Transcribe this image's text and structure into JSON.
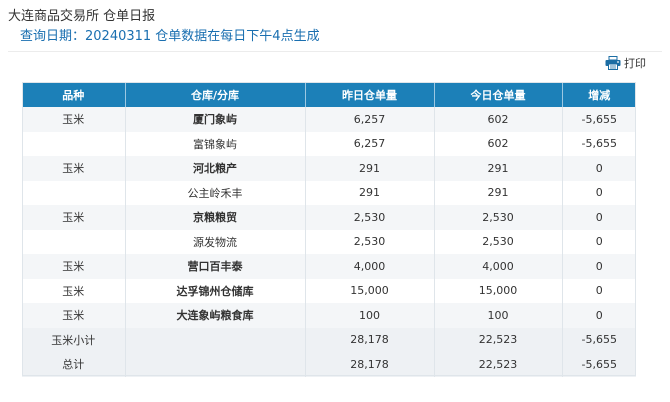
{
  "header": {
    "title": "大连商品交易所 仓单日报",
    "subtitle": "查询日期：20240311 仓单数据在每日下午4点生成"
  },
  "toolbar": {
    "print_label": "打印",
    "print_icon": "printer-icon"
  },
  "table": {
    "headers": [
      "品种",
      "仓库/分库",
      "昨日仓单量",
      "今日仓单量",
      "增减"
    ],
    "rows": [
      {
        "variety": "玉米",
        "warehouse": "厦门象屿",
        "yesterday": "6,257",
        "today": "602",
        "change": "-5,655"
      },
      {
        "variety": "",
        "warehouse": "富锦象屿",
        "yesterday": "6,257",
        "today": "602",
        "change": "-5,655"
      },
      {
        "variety": "玉米",
        "warehouse": "河北粮产",
        "yesterday": "291",
        "today": "291",
        "change": "0"
      },
      {
        "variety": "",
        "warehouse": "公主岭禾丰",
        "yesterday": "291",
        "today": "291",
        "change": "0"
      },
      {
        "variety": "玉米",
        "warehouse": "京粮粮贸",
        "yesterday": "2,530",
        "today": "2,530",
        "change": "0"
      },
      {
        "variety": "",
        "warehouse": "源发物流",
        "yesterday": "2,530",
        "today": "2,530",
        "change": "0"
      },
      {
        "variety": "玉米",
        "warehouse": "营口百丰泰",
        "yesterday": "4,000",
        "today": "4,000",
        "change": "0"
      },
      {
        "variety": "玉米",
        "warehouse": "达孚锦州仓储库",
        "yesterday": "15,000",
        "today": "15,000",
        "change": "0"
      },
      {
        "variety": "玉米",
        "warehouse": "大连象屿粮食库",
        "yesterday": "100",
        "today": "100",
        "change": "0"
      },
      {
        "variety": "玉米小计",
        "warehouse": "",
        "yesterday": "28,178",
        "today": "22,523",
        "change": "-5,655"
      },
      {
        "variety": "总计",
        "warehouse": "",
        "yesterday": "28,178",
        "today": "22,523",
        "change": "-5,655"
      }
    ]
  },
  "colors": {
    "header_bg": "#1c80b8",
    "subtitle": "#1a6fb0",
    "row_alt": "#f4f6f8"
  }
}
